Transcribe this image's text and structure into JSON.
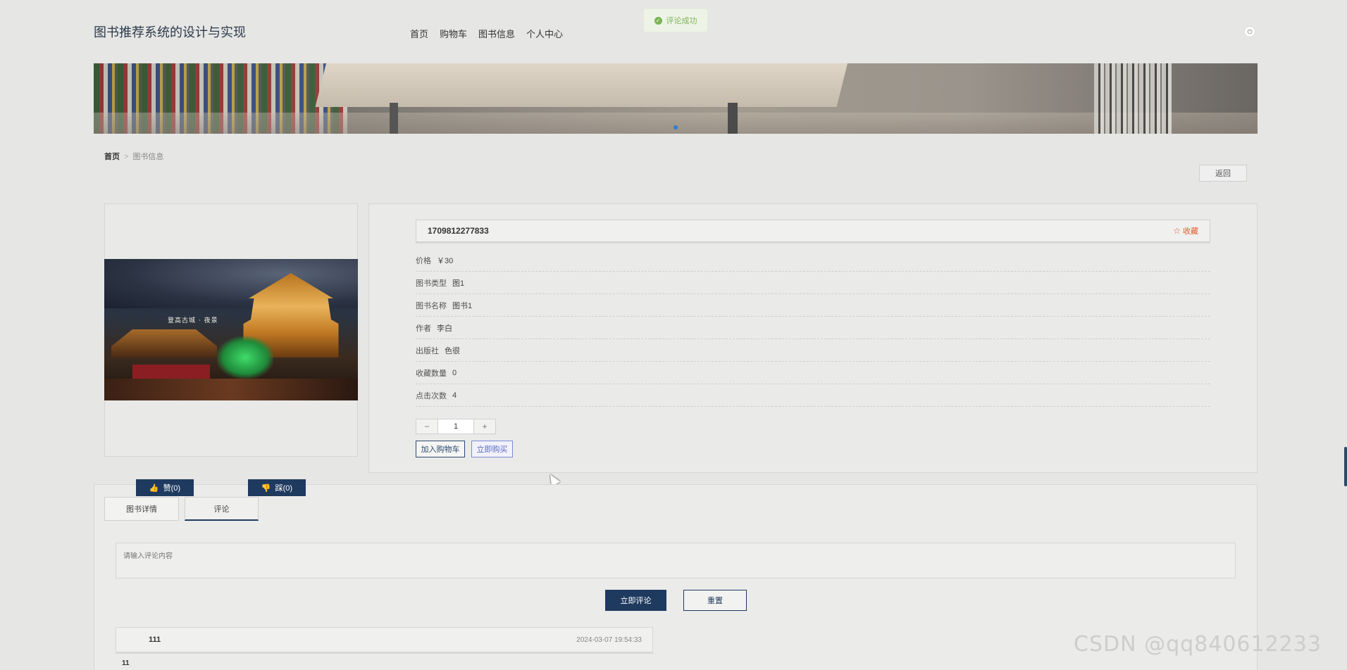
{
  "header": {
    "site_title": "图书推荐系统的设计与实现",
    "nav": [
      "首页",
      "购物车",
      "图书信息",
      "个人中心"
    ],
    "toast": "评论成功"
  },
  "breadcrumb": {
    "home": "首页",
    "separator": ">",
    "current": "图书信息"
  },
  "back_label": "返回",
  "book": {
    "image_caption": "登高古城 · 夜景",
    "title": "1709812277833",
    "favorite_label": "收藏",
    "fields": [
      {
        "label": "价格",
        "value": "￥30"
      },
      {
        "label": "图书类型",
        "value": "图1"
      },
      {
        "label": "图书名称",
        "value": "图书1"
      },
      {
        "label": "作者",
        "value": "李白"
      },
      {
        "label": "出版社",
        "value": "色很"
      },
      {
        "label": "收藏数量",
        "value": "0"
      },
      {
        "label": "点击次数",
        "value": "4"
      }
    ],
    "quantity": "1",
    "stepper_minus": "−",
    "stepper_plus": "+",
    "add_to_cart": "加入购物车",
    "buy_now": "立即购买"
  },
  "votes": {
    "like": "赞(0)",
    "dislike": "踩(0)"
  },
  "tabs": {
    "detail": "图书详情",
    "comment": "评论"
  },
  "comment_form": {
    "placeholder": "请输入评论内容",
    "submit": "立即评论",
    "reset": "重置"
  },
  "comments": [
    {
      "user": "111",
      "time": "2024-03-07 19:54:33",
      "content": "11"
    }
  ],
  "watermark": "CSDN @qq840612233",
  "colors": {
    "primary": "#1f3a5f",
    "favorite": "#e0582e",
    "toast_success": "#7bb455"
  }
}
